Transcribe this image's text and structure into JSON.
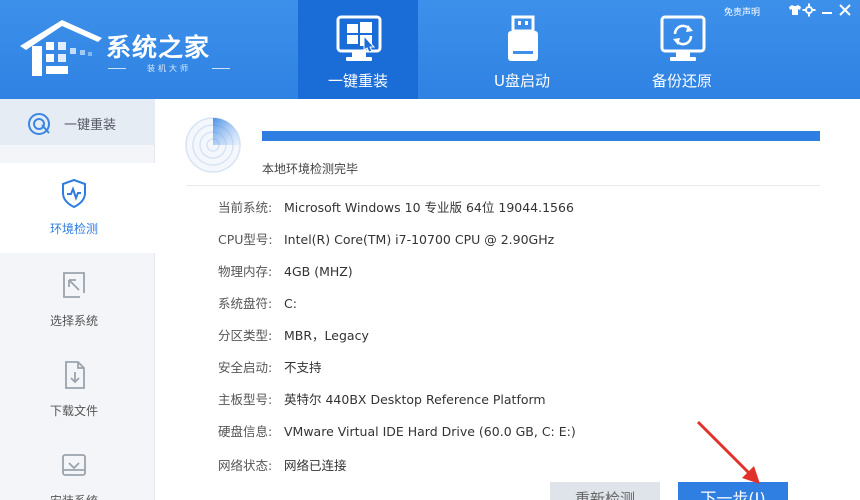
{
  "brand": {
    "title": "系统之家",
    "subtitle": "装机大师"
  },
  "topbar": {
    "disclaimer": "免责声明",
    "icons": [
      "shirt-icon",
      "settings-icon",
      "minimize-icon",
      "close-icon"
    ]
  },
  "nav": {
    "tabs": [
      {
        "label": "一键重装",
        "icon": "windows-install-icon",
        "active": true
      },
      {
        "label": "U盘启动",
        "icon": "usb-drive-icon",
        "active": false
      },
      {
        "label": "备份还原",
        "icon": "backup-restore-icon",
        "active": false
      }
    ]
  },
  "sidebar": {
    "header": {
      "label": "一键重装",
      "icon": "reinstall-icon"
    },
    "items": [
      {
        "label": "环境检测",
        "icon": "shield-pulse-icon",
        "active": true
      },
      {
        "label": "选择系统",
        "icon": "select-cursor-icon",
        "active": false
      },
      {
        "label": "下载文件",
        "icon": "download-file-icon",
        "active": false
      },
      {
        "label": "安装系统",
        "icon": "install-tray-icon",
        "active": false
      }
    ]
  },
  "main": {
    "progress_percent": 100,
    "status": "本地环境检测完毕",
    "info": [
      {
        "label": "当前系统:",
        "value": "Microsoft Windows 10 专业版 64位 19044.1566"
      },
      {
        "label": "CPU型号:",
        "value": "Intel(R) Core(TM) i7-10700 CPU @ 2.90GHz"
      },
      {
        "label": "物理内存:",
        "value": "4GB (MHZ)"
      },
      {
        "label": "系统盘符:",
        "value": "C:"
      },
      {
        "label": "分区类型:",
        "value": "MBR，Legacy"
      },
      {
        "label": "安全启动:",
        "value": "不支持"
      },
      {
        "label": "主板型号:",
        "value": "英特尔 440BX Desktop Reference Platform"
      },
      {
        "label": "硬盘信息:",
        "value": "VMware Virtual IDE Hard Drive  (60.0 GB, C: E:)"
      },
      {
        "label": "网络状态:",
        "value": "网络已连接"
      }
    ],
    "buttons": {
      "recheck": "重新检测",
      "next": "下一步(I)"
    }
  },
  "colors": {
    "header": "#3d90ea",
    "accent": "#2f7ee2",
    "annotation_arrow": "#e0322b"
  }
}
